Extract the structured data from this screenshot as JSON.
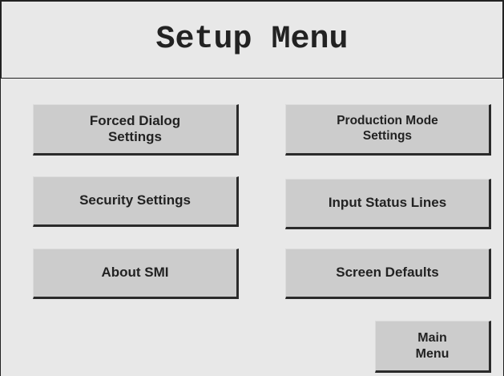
{
  "title": "Setup Menu",
  "buttons": {
    "forced_dialog": "Forced Dialog\nSettings",
    "production_mode": "Production Mode\nSettings",
    "security": "Security Settings",
    "input_status": "Input Status Lines",
    "about": "About SMI",
    "screen_defaults": "Screen Defaults",
    "main_menu": "Main\nMenu"
  },
  "colors": {
    "background": "#e8e8e8",
    "button_face": "#cccccc",
    "button_shadow": "#2a2a2a",
    "text": "#222222"
  }
}
